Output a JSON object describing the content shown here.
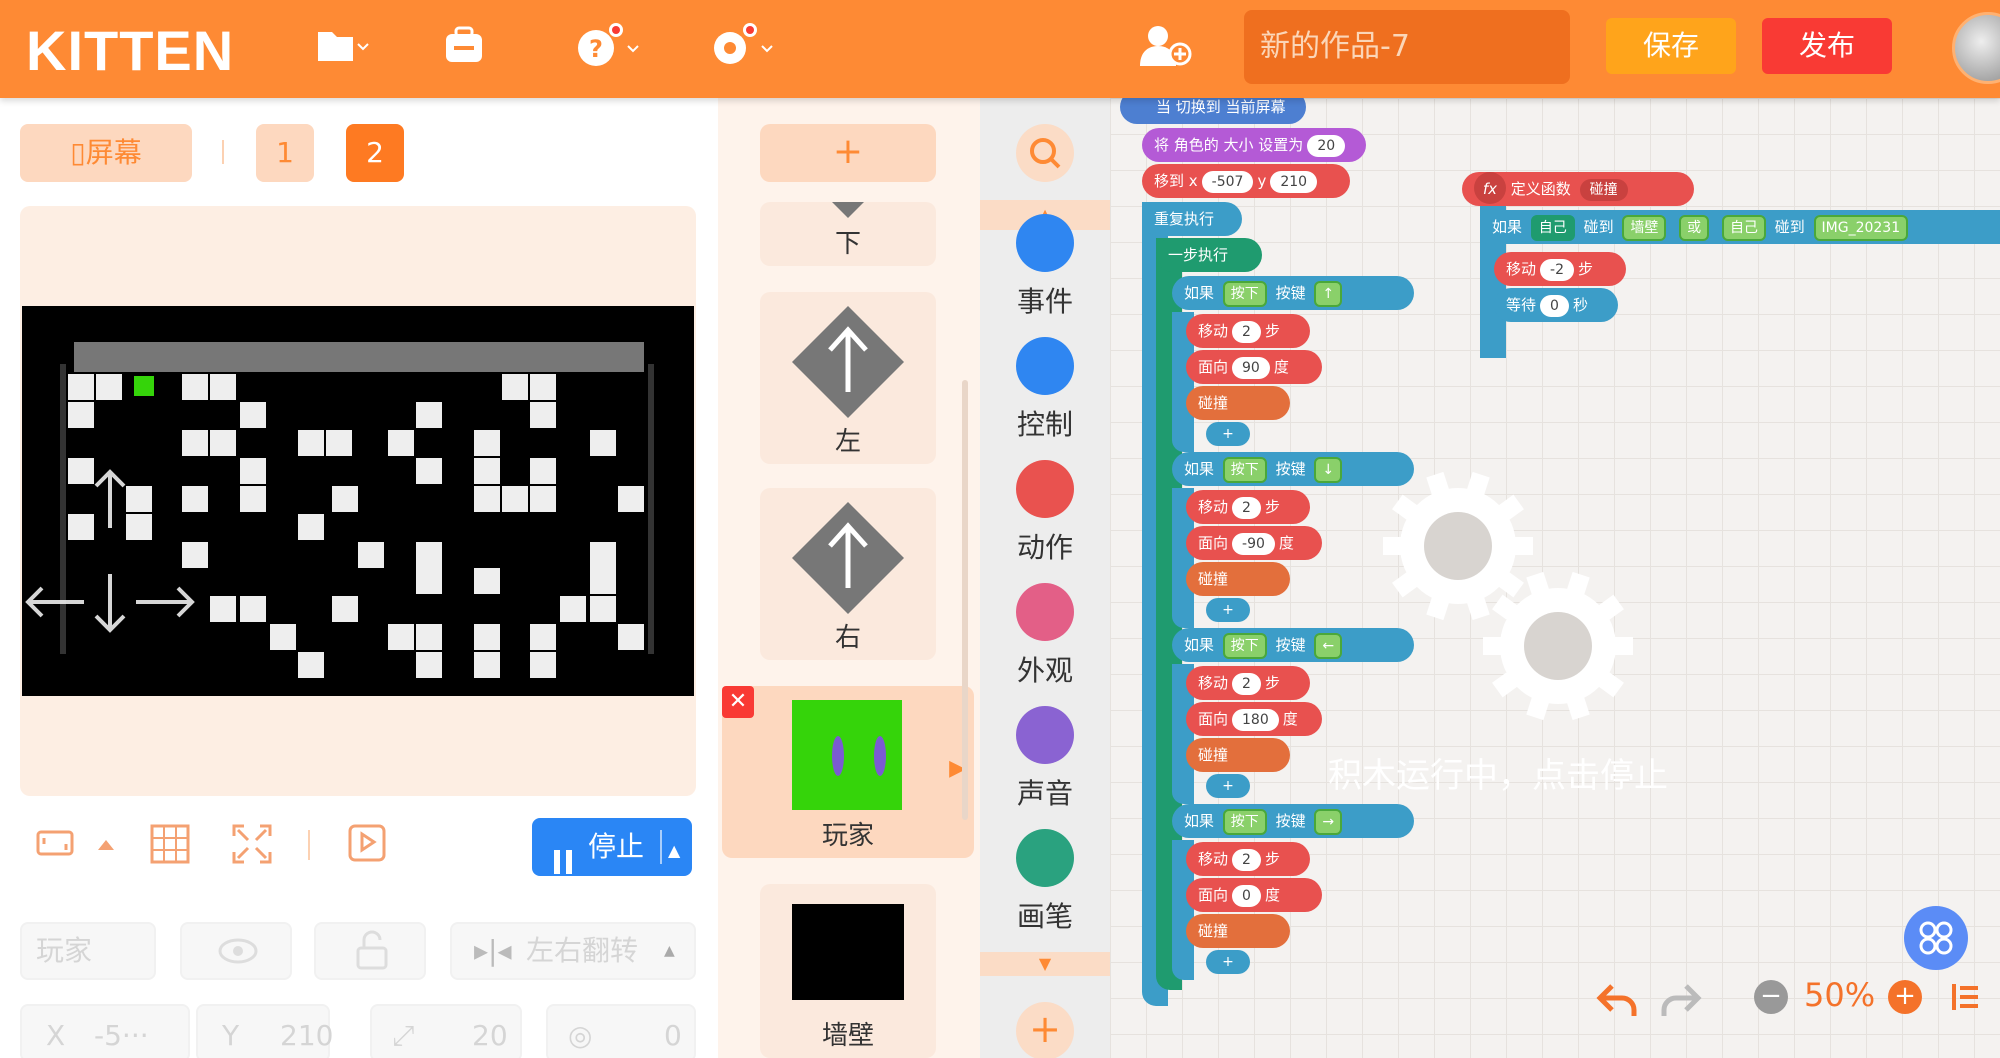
{
  "app": {
    "logo": "KITTEN",
    "project_name": "新的作品-7",
    "save_label": "保存",
    "publish_label": "发布"
  },
  "tabs": {
    "screen_label": "屏幕",
    "tab1": "1",
    "tab2": "2"
  },
  "stage_controls": {
    "stop_label": "停止"
  },
  "props": {
    "name": "玩家",
    "flip_label": "左右翻转",
    "x_label": "X",
    "x_value": "-5···",
    "y_label": "Y",
    "y_value": "210",
    "size_value": "20",
    "rotation_value": "0"
  },
  "sprites": {
    "add_label": "+",
    "items": [
      {
        "label": "下"
      },
      {
        "label": "左"
      },
      {
        "label": "右"
      },
      {
        "label": "玩家"
      },
      {
        "label": "墙壁"
      }
    ]
  },
  "categories": [
    {
      "label": "事件",
      "color": "#2f86f1"
    },
    {
      "label": "控制",
      "color": "#2f86f1"
    },
    {
      "label": "动作",
      "color": "#e9524f"
    },
    {
      "label": "外观",
      "color": "#e35f87"
    },
    {
      "label": "声音",
      "color": "#8a63d2"
    },
    {
      "label": "画笔",
      "color": "#2aa27f"
    }
  ],
  "script": {
    "hat": "当 切换到 当前屏幕",
    "set_size": "将 角色的 大小 设置为",
    "set_size_val": "20",
    "move_to": "移到 x",
    "x_val": "-507",
    "y_label": "y",
    "y_val": "210",
    "repeat": "重复执行",
    "step": "一步执行",
    "if": "如果",
    "press": "按下",
    "key": "按键",
    "move": "移动",
    "steps": "步",
    "face": "面向",
    "deg": "度",
    "collide": "碰撞",
    "keys": [
      "↑",
      "↓",
      "←",
      "→"
    ],
    "move_vals": [
      "2",
      "2",
      "2",
      "2"
    ],
    "face_vals": [
      "90",
      "-90",
      "180",
      "0"
    ],
    "def_func": "定义函数",
    "func_name": "碰撞",
    "self": "自己",
    "touch": "碰到",
    "wall": "墙壁",
    "or": "或",
    "img": "IMG_20231",
    "move2": "-2",
    "wait": "等待",
    "wait_val": "0",
    "sec": "秒"
  },
  "overlay": {
    "text": "积木运行中，点击停止"
  },
  "zoom": {
    "value": "50%"
  }
}
